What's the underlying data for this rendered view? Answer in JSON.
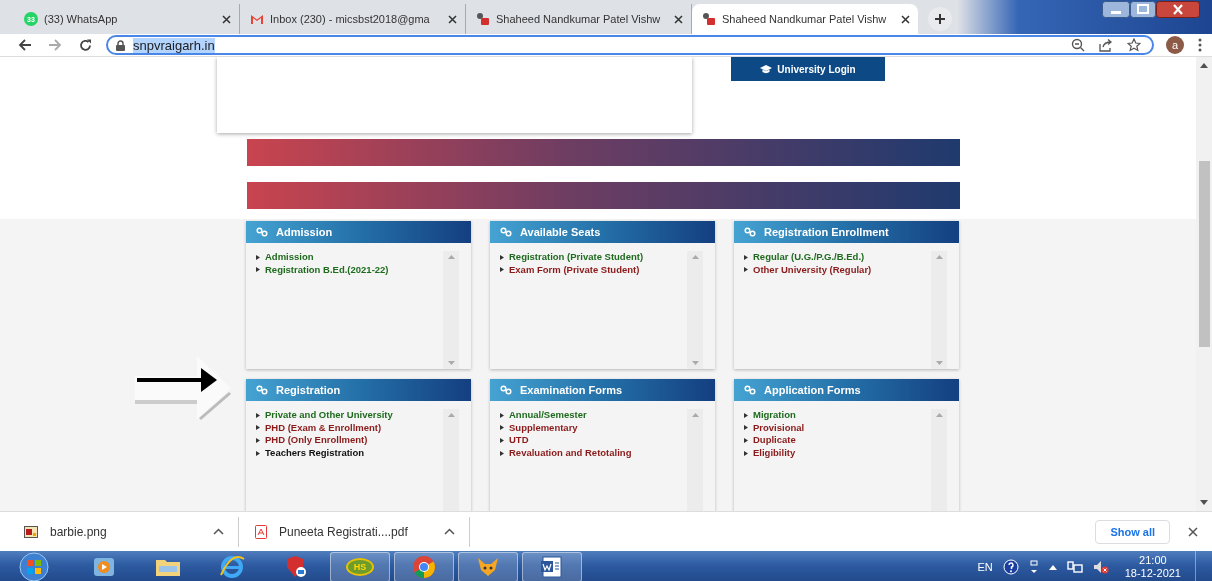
{
  "browser_tabs": [
    {
      "title": "(33) WhatsApp",
      "kind": "whatsapp",
      "favicon_badge": "33",
      "selected": false
    },
    {
      "title": "Inbox (230) - micsbst2018@gma",
      "kind": "gmail",
      "selected": false
    },
    {
      "title": "Shaheed Nandkumar Patel Vishw",
      "kind": "site",
      "selected": false
    },
    {
      "title": "Shaheed Nandkumar Patel Vishw",
      "kind": "site",
      "selected": true
    }
  ],
  "address_bar": {
    "url": "snpvraigarh.in",
    "text_selected": true,
    "avatar": "a"
  },
  "page": {
    "login_button": "University Login",
    "panels": [
      {
        "title": "Admission",
        "links": [
          {
            "label": "Admission",
            "color": "#1e6b1e"
          },
          {
            "label": "Registration B.Ed.(2021-22)",
            "color": "#1e6b1e"
          }
        ]
      },
      {
        "title": "Available Seats",
        "links": [
          {
            "label": "Registration (Private Student)",
            "color": "#1e6b1e"
          },
          {
            "label": "Exam Form (Private Student)",
            "color": "#8b1a1a"
          }
        ]
      },
      {
        "title": "Registration Enrollment",
        "links": [
          {
            "label": "Regular (U.G./P.G./B.Ed.)",
            "color": "#1e6b1e"
          },
          {
            "label": "Other University (Regular)",
            "color": "#8b1a1a"
          }
        ]
      },
      {
        "title": "Registration",
        "links": [
          {
            "label": "Private and Other University",
            "color": "#1e6b1e"
          },
          {
            "label": "PHD (Exam & Enrollment)",
            "color": "#8b1a1a"
          },
          {
            "label": "PHD (Only Enrollment)",
            "color": "#8b1a1a"
          },
          {
            "label": "Teachers Registration",
            "color": "#111111"
          }
        ]
      },
      {
        "title": "Examination Forms",
        "links": [
          {
            "label": "Annual/Semester",
            "color": "#1e6b1e"
          },
          {
            "label": "Supplementary",
            "color": "#8b1a1a"
          },
          {
            "label": "UTD",
            "color": "#8b1a1a"
          },
          {
            "label": "Revaluation and Retotaling",
            "color": "#8b1a1a"
          }
        ]
      },
      {
        "title": "Application Forms",
        "links": [
          {
            "label": "Migration",
            "color": "#1e6b1e"
          },
          {
            "label": "Provisional",
            "color": "#8b1a1a"
          },
          {
            "label": "Duplicate",
            "color": "#8b1a1a"
          },
          {
            "label": "Eligibility",
            "color": "#8b1a1a"
          }
        ]
      }
    ]
  },
  "downloads": [
    {
      "filename": "barbie.png",
      "kind": "image"
    },
    {
      "filename": "Puneeta Registrati....pdf",
      "kind": "pdf"
    }
  ],
  "show_all": "Show all",
  "taskbar": {
    "apps": [
      {
        "kind": "media",
        "running": false
      },
      {
        "kind": "folder",
        "running": false
      },
      {
        "kind": "ie",
        "running": false
      },
      {
        "kind": "shield",
        "running": false
      },
      {
        "kind": "hs",
        "label": "HS",
        "running": true
      },
      {
        "kind": "chrome",
        "running": true
      },
      {
        "kind": "fox",
        "running": true
      },
      {
        "kind": "word",
        "running": true
      }
    ],
    "tray": {
      "language": "EN",
      "time": "21:00",
      "date": "18-12-2021"
    }
  }
}
